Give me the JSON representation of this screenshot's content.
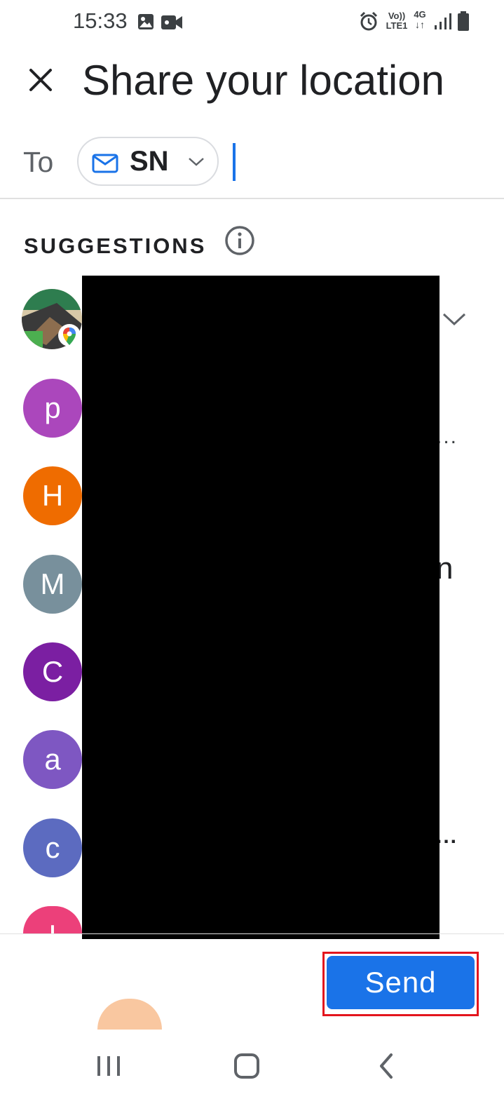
{
  "status_bar": {
    "time": "15:33",
    "net_top": "Vo))",
    "net_bottom": "LTE1",
    "net_type": "4G",
    "icons": [
      "gallery-icon",
      "video-camera-icon",
      "alarm-icon",
      "volte-icon",
      "4g-data-icon",
      "signal-icon",
      "battery-icon"
    ]
  },
  "header": {
    "title": "Share your location",
    "close_icon": "close-icon"
  },
  "recipient": {
    "to_label": "To",
    "chip_label": "SN",
    "chip_icon": "mail-icon"
  },
  "suggestions": {
    "label": "SUGGESTIONS",
    "info_icon": "info-icon",
    "items": [
      {
        "kind": "photo",
        "badge": "google-maps-icon"
      },
      {
        "initial": "p",
        "color": "#ab47bc"
      },
      {
        "initial": "H",
        "color": "#ef6c00"
      },
      {
        "initial": "M",
        "color": "#78909c"
      },
      {
        "initial": "C",
        "color": "#7b1fa2"
      },
      {
        "initial": "a",
        "color": "#7e57c2"
      },
      {
        "initial": "c",
        "color": "#5c6bc0"
      },
      {
        "initial": "I",
        "color": "#ec407a"
      }
    ],
    "ellipsis": "...",
    "name_fragment": "n"
  },
  "footer": {
    "send_label": "Send"
  },
  "colors": {
    "accent": "#1a73e8",
    "highlight": "#e3151d",
    "divider": "#e0e0e0"
  }
}
